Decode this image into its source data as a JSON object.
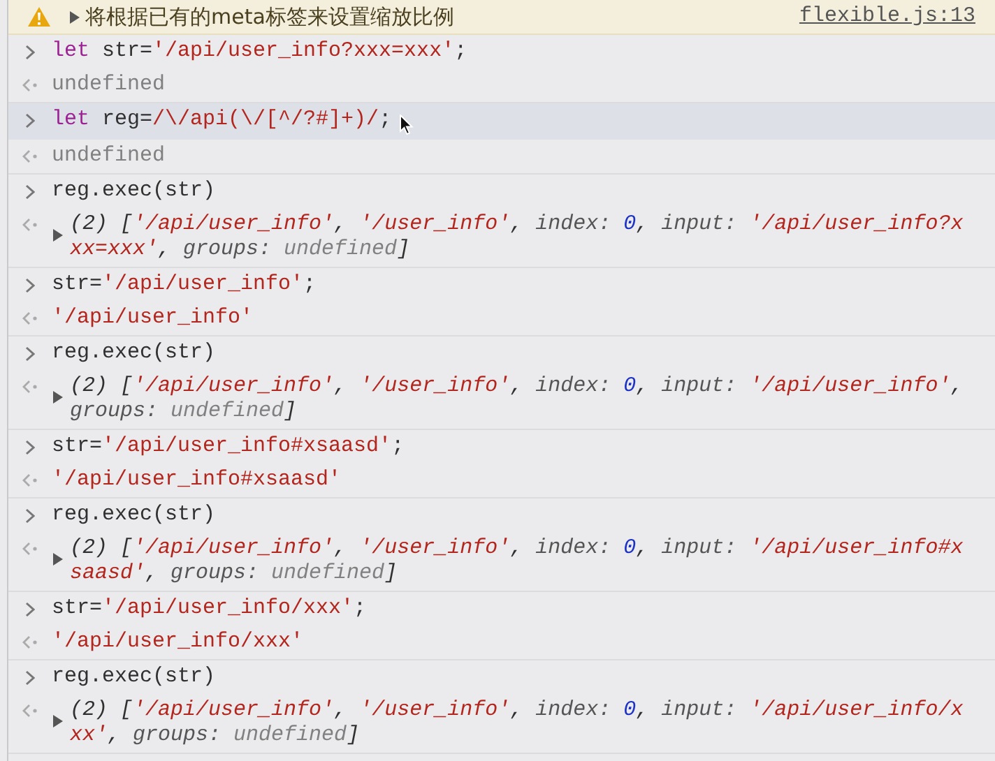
{
  "messages": [
    {
      "kind": "warning",
      "expanded": false,
      "text": "将根据已有的meta标签来设置缩放比例",
      "source": "flexible.js:13"
    },
    {
      "kind": "command",
      "hovered": false,
      "input": [
        {
          "kind": "keyword",
          "text": "let "
        },
        {
          "kind": "plain",
          "text": "str="
        },
        {
          "kind": "string",
          "text": "'/api/user_info?xxx=xxx'"
        },
        {
          "kind": "plain",
          "text": ";"
        }
      ],
      "result": {
        "kind": "value",
        "tokens": [
          {
            "kind": "null",
            "text": "undefined"
          }
        ]
      }
    },
    {
      "kind": "command",
      "hovered": true,
      "input": [
        {
          "kind": "keyword",
          "text": "let "
        },
        {
          "kind": "plain",
          "text": "reg="
        },
        {
          "kind": "string",
          "text": "/\\/api(\\/[^/?#]+)/"
        },
        {
          "kind": "plain",
          "text": ";"
        }
      ],
      "result": {
        "kind": "value",
        "tokens": [
          {
            "kind": "null",
            "text": "undefined"
          }
        ]
      }
    },
    {
      "kind": "command",
      "hovered": false,
      "input": [
        {
          "kind": "plain",
          "text": "reg.exec(str)"
        }
      ],
      "result": {
        "kind": "array",
        "expanded": false,
        "tokens": [
          {
            "kind": "plain",
            "text": "(2) ["
          },
          {
            "kind": "string",
            "text": "'/api/user_info'"
          },
          {
            "kind": "plain",
            "text": ", "
          },
          {
            "kind": "string",
            "text": "'/user_info'"
          },
          {
            "kind": "plain",
            "text": ", "
          },
          {
            "kind": "property",
            "text": "index: "
          },
          {
            "kind": "number",
            "text": "0"
          },
          {
            "kind": "plain",
            "text": ", "
          },
          {
            "kind": "property",
            "text": "input: "
          },
          {
            "kind": "string",
            "text": "'/api/user_info?xxx=xxx'"
          },
          {
            "kind": "plain",
            "text": ", "
          },
          {
            "kind": "property",
            "text": "groups: "
          },
          {
            "kind": "null",
            "text": "undefined"
          },
          {
            "kind": "plain",
            "text": "]"
          }
        ]
      }
    },
    {
      "kind": "command",
      "hovered": false,
      "input": [
        {
          "kind": "plain",
          "text": "str="
        },
        {
          "kind": "string",
          "text": "'/api/user_info'"
        },
        {
          "kind": "plain",
          "text": ";"
        }
      ],
      "result": {
        "kind": "value",
        "tokens": [
          {
            "kind": "string",
            "text": "'/api/user_info'"
          }
        ]
      }
    },
    {
      "kind": "command",
      "hovered": false,
      "input": [
        {
          "kind": "plain",
          "text": "reg.exec(str)"
        }
      ],
      "result": {
        "kind": "array",
        "expanded": false,
        "tokens": [
          {
            "kind": "plain",
            "text": "(2) ["
          },
          {
            "kind": "string",
            "text": "'/api/user_info'"
          },
          {
            "kind": "plain",
            "text": ", "
          },
          {
            "kind": "string",
            "text": "'/user_info'"
          },
          {
            "kind": "plain",
            "text": ", "
          },
          {
            "kind": "property",
            "text": "index: "
          },
          {
            "kind": "number",
            "text": "0"
          },
          {
            "kind": "plain",
            "text": ", "
          },
          {
            "kind": "property",
            "text": "input: "
          },
          {
            "kind": "string",
            "text": "'/api/user_info'"
          },
          {
            "kind": "plain",
            "text": ", "
          },
          {
            "kind": "property",
            "text": "groups: "
          },
          {
            "kind": "null",
            "text": "undefined"
          },
          {
            "kind": "plain",
            "text": "]"
          }
        ]
      }
    },
    {
      "kind": "command",
      "hovered": false,
      "input": [
        {
          "kind": "plain",
          "text": "str="
        },
        {
          "kind": "string",
          "text": "'/api/user_info#xsaasd'"
        },
        {
          "kind": "plain",
          "text": ";"
        }
      ],
      "result": {
        "kind": "value",
        "tokens": [
          {
            "kind": "string",
            "text": "'/api/user_info#xsaasd'"
          }
        ]
      }
    },
    {
      "kind": "command",
      "hovered": false,
      "input": [
        {
          "kind": "plain",
          "text": "reg.exec(str)"
        }
      ],
      "result": {
        "kind": "array",
        "expanded": false,
        "tokens": [
          {
            "kind": "plain",
            "text": "(2) ["
          },
          {
            "kind": "string",
            "text": "'/api/user_info'"
          },
          {
            "kind": "plain",
            "text": ", "
          },
          {
            "kind": "string",
            "text": "'/user_info'"
          },
          {
            "kind": "plain",
            "text": ", "
          },
          {
            "kind": "property",
            "text": "index: "
          },
          {
            "kind": "number",
            "text": "0"
          },
          {
            "kind": "plain",
            "text": ", "
          },
          {
            "kind": "property",
            "text": "input: "
          },
          {
            "kind": "string",
            "text": "'/api/user_info#xsaasd'"
          },
          {
            "kind": "plain",
            "text": ", "
          },
          {
            "kind": "property",
            "text": "groups: "
          },
          {
            "kind": "null",
            "text": "undefined"
          },
          {
            "kind": "plain",
            "text": "]"
          }
        ]
      }
    },
    {
      "kind": "command",
      "hovered": false,
      "input": [
        {
          "kind": "plain",
          "text": "str="
        },
        {
          "kind": "string",
          "text": "'/api/user_info/xxx'"
        },
        {
          "kind": "plain",
          "text": ";"
        }
      ],
      "result": {
        "kind": "value",
        "tokens": [
          {
            "kind": "string",
            "text": "'/api/user_info/xxx'"
          }
        ]
      }
    },
    {
      "kind": "command",
      "hovered": false,
      "input": [
        {
          "kind": "plain",
          "text": "reg.exec(str)"
        }
      ],
      "result": {
        "kind": "array",
        "expanded": false,
        "tokens": [
          {
            "kind": "plain",
            "text": "(2) ["
          },
          {
            "kind": "string",
            "text": "'/api/user_info'"
          },
          {
            "kind": "plain",
            "text": ", "
          },
          {
            "kind": "string",
            "text": "'/user_info'"
          },
          {
            "kind": "plain",
            "text": ", "
          },
          {
            "kind": "property",
            "text": "index: "
          },
          {
            "kind": "number",
            "text": "0"
          },
          {
            "kind": "plain",
            "text": ", "
          },
          {
            "kind": "property",
            "text": "input: "
          },
          {
            "kind": "string",
            "text": "'/api/user_info/xxx'"
          },
          {
            "kind": "plain",
            "text": ", "
          },
          {
            "kind": "property",
            "text": "groups: "
          },
          {
            "kind": "null",
            "text": "undefined"
          },
          {
            "kind": "plain",
            "text": "]"
          }
        ]
      }
    }
  ]
}
